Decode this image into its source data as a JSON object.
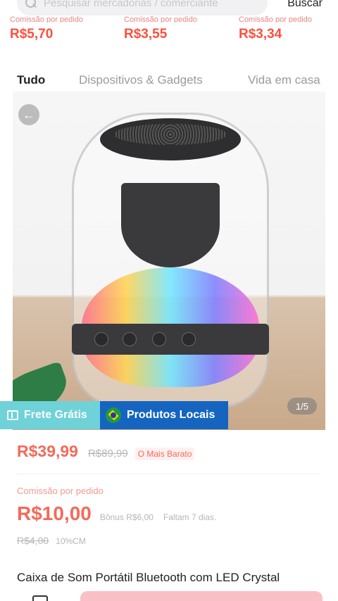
{
  "search": {
    "placeholder": "Pesquisar mercadorias / comerciante",
    "button_label": "Buscar"
  },
  "previous_row": [
    {
      "label": "Comissão por pedido",
      "price": "R$5,70"
    },
    {
      "label": "Comissão por pedido",
      "price": "R$3,55"
    },
    {
      "label": "Comissão por pedido",
      "price": "R$3,34"
    }
  ],
  "tabs": [
    {
      "label": "Tudo"
    },
    {
      "label": "Dispositivos & Gadgets"
    },
    {
      "label": "Vida em casa"
    }
  ],
  "product": {
    "image_page": "1/5",
    "badges": {
      "free_shipping": "Frete Grátis",
      "local_products": "Produtos Locais"
    },
    "price": "R$39,99",
    "original_price": "R$89,99",
    "cheapest_tag": "O Mais Barato",
    "commission_label": "Comissão por pedido",
    "commission_value": "R$10,00",
    "bonus": "Bônus R$6,00",
    "remaining": "Faltam 7 dias.",
    "old_commission": "R$4,00",
    "commission_rate": "10%CM",
    "title": "Caixa de Som Portátil Bluetooth com LED Crystal"
  },
  "colors": {
    "accent": "#f46a5a",
    "free_shipping_bg": "#6fd2d8",
    "local_badge_bg": "#1565c0"
  },
  "icons": [
    "search-icon",
    "back-arrow-icon",
    "truck-icon",
    "brazil-flag-icon",
    "bottom-nav-icon"
  ]
}
